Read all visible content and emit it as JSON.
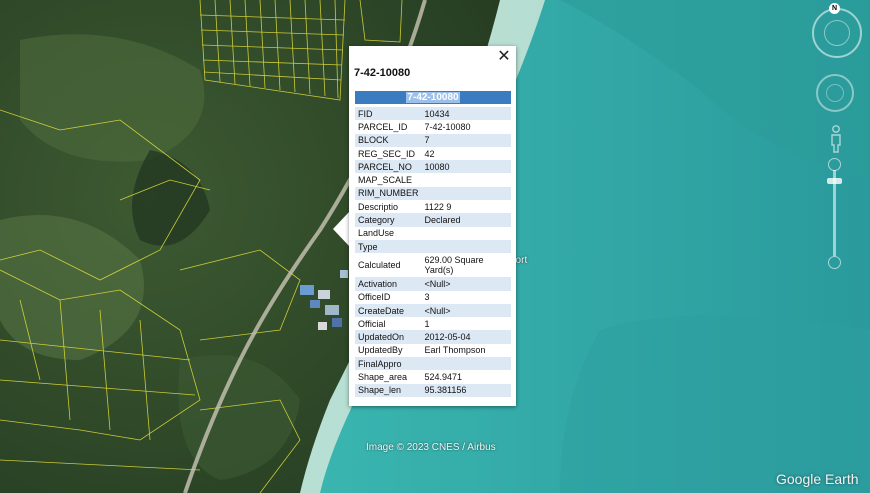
{
  "popup": {
    "title": "7-42-10080",
    "header": "7-42-10080",
    "close_label": "✕",
    "rows": [
      {
        "key": "FID",
        "value": "10434"
      },
      {
        "key": "PARCEL_ID",
        "value": "7-42-10080"
      },
      {
        "key": "BLOCK",
        "value": "7"
      },
      {
        "key": "REG_SEC_ID",
        "value": "42"
      },
      {
        "key": "PARCEL_NO",
        "value": "10080"
      },
      {
        "key": "MAP_SCALE",
        "value": ""
      },
      {
        "key": "RIM_NUMBER",
        "value": ""
      },
      {
        "key": "Descriptio",
        "value": "1122 9"
      },
      {
        "key": "Category",
        "value": "Declared"
      },
      {
        "key": "LandUse",
        "value": ""
      },
      {
        "key": "Type",
        "value": ""
      },
      {
        "key": "Calculated",
        "value": "629.00 Square Yard(s)"
      },
      {
        "key": "Activation",
        "value": "<Null>"
      },
      {
        "key": "OfficeID",
        "value": "3"
      },
      {
        "key": "CreateDate",
        "value": "<Null>"
      },
      {
        "key": "Official",
        "value": "1"
      },
      {
        "key": "UpdatedOn",
        "value": "2012-05-04"
      },
      {
        "key": "UpdatedBy",
        "value": "Earl Thompson"
      },
      {
        "key": "FinalAppro",
        "value": ""
      },
      {
        "key": "Shape_area",
        "value": "524.9471"
      },
      {
        "key": "Shape_len",
        "value": "95.381156"
      }
    ]
  },
  "map": {
    "place_label": "esort",
    "attribution": "Image © 2023 CNES / Airbus",
    "brand": "Google Earth",
    "north_label": "N",
    "colors": {
      "sea": "#3fb3b0",
      "land": "#2f4a2a",
      "parcel_lines": "#e6e23a",
      "popup_header": "#3b7bbf",
      "row_alt": "#dde8f5"
    }
  }
}
